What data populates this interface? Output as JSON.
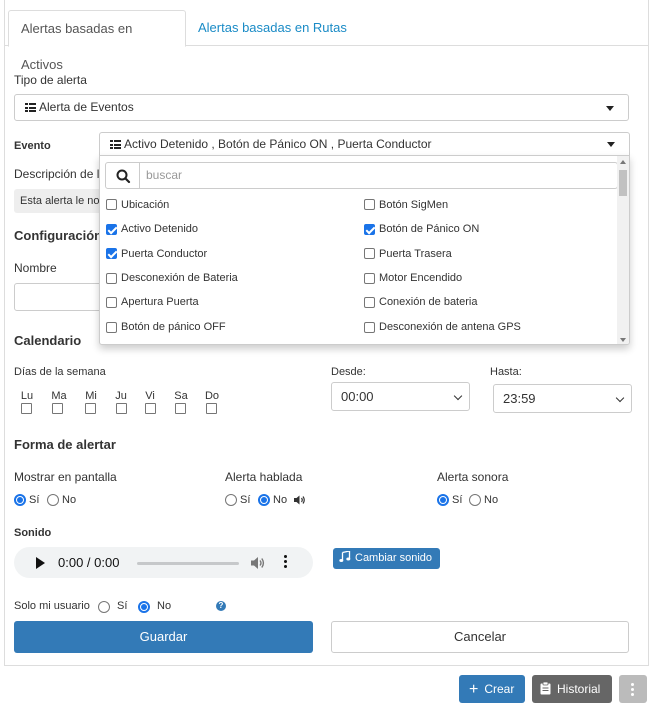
{
  "tabs": [
    {
      "label": "Alertas basadas en Activos",
      "active": true
    },
    {
      "label": "Alertas basadas en Rutas",
      "active": false
    }
  ],
  "colors": {
    "primary": "#337ab7",
    "link": "#1a8bc6",
    "checked": "#1a73e8"
  },
  "tipo_alerta": {
    "label": "Tipo de alerta",
    "value": "Alerta de Eventos",
    "icon": "list-icon"
  },
  "evento": {
    "label": "Evento",
    "value": "Activo Detenido , Botón de Pánico ON , Puerta Conductor",
    "icon": "list-icon",
    "search_placeholder": "buscar",
    "options": [
      {
        "label": "Ubicación",
        "checked": false
      },
      {
        "label": "Botón SigMen",
        "checked": false
      },
      {
        "label": "Activo Detenido",
        "checked": true
      },
      {
        "label": "Botón de Pánico ON",
        "checked": true
      },
      {
        "label": "Puerta Conductor",
        "checked": true
      },
      {
        "label": "Puerta Trasera",
        "checked": false
      },
      {
        "label": "Desconexión de Bateria",
        "checked": false
      },
      {
        "label": "Motor Encendido",
        "checked": false
      },
      {
        "label": "Apertura Puerta",
        "checked": false
      },
      {
        "label": "Conexión de bateria",
        "checked": false
      },
      {
        "label": "Botón de pánico OFF",
        "checked": false
      },
      {
        "label": "Desconexión de antena GPS",
        "checked": false
      }
    ]
  },
  "descripcion": {
    "label": "Descripción de la",
    "value": "Esta alerta le noti"
  },
  "configuracion": {
    "title": "Configuración",
    "nombre_label": "Nombre",
    "nombre_value": ""
  },
  "calendario": {
    "title": "Calendario",
    "dias_label": "Días de la semana",
    "dias": [
      "Lu",
      "Ma",
      "Mi",
      "Ju",
      "Vi",
      "Sa",
      "Do"
    ],
    "desde_label": "Desde:",
    "desde_value": "00:00",
    "hasta_label": "Hasta:",
    "hasta_value": "23:59"
  },
  "forma": {
    "title": "Forma de alertar",
    "si": "Sí",
    "no": "No",
    "mostrar_pantalla": {
      "label": "Mostrar en pantalla",
      "selected": "si"
    },
    "alerta_hablada": {
      "label": "Alerta hablada",
      "selected": "no"
    },
    "alerta_sonora": {
      "label": "Alerta sonora",
      "selected": "si"
    }
  },
  "sonido": {
    "label": "Sonido",
    "time": "0:00 / 0:00",
    "change_button": "Cambiar sonido"
  },
  "solo_usuario": {
    "label": "Solo mi usuario",
    "selected": "no"
  },
  "actions": {
    "save": "Guardar",
    "cancel": "Cancelar"
  },
  "footer": {
    "crear": "Crear",
    "historial": "Historial"
  }
}
